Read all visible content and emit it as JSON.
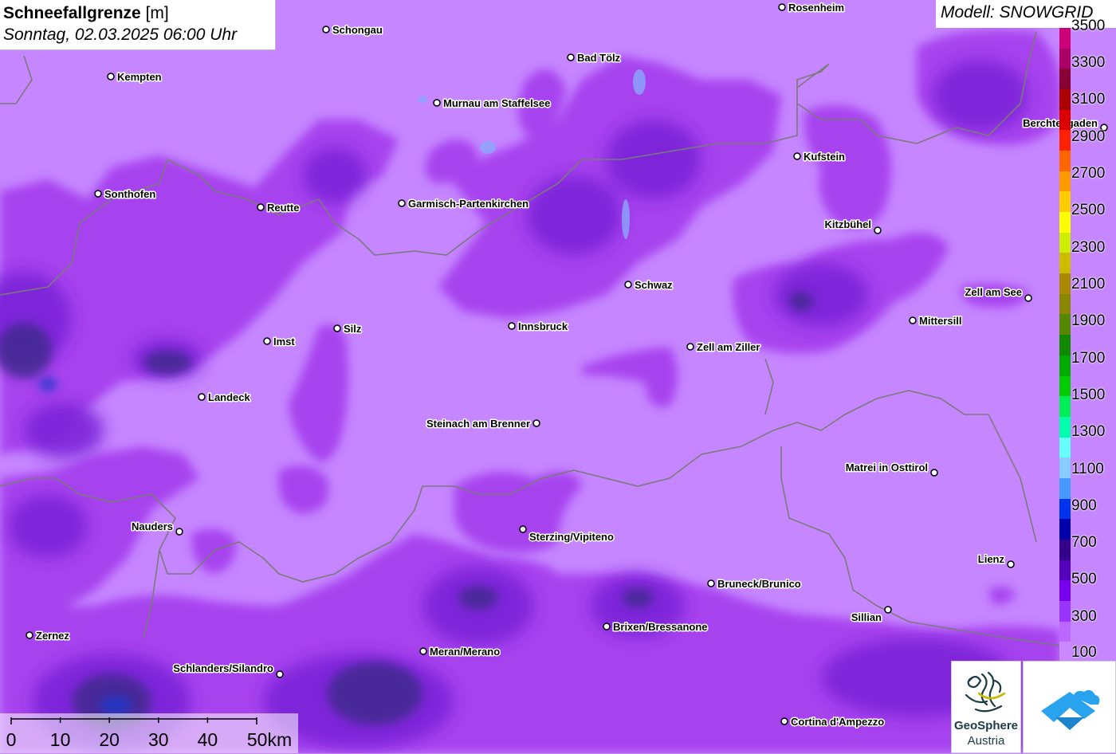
{
  "title": {
    "variable": "Schneefallgrenze",
    "unit": "[m]",
    "datetime": "Sonntag, 02.03.2025 06:00 Uhr"
  },
  "model": "Modell: SNOWGRID",
  "legend": {
    "labels": [
      "3500",
      "3300",
      "3100",
      "2900",
      "2700",
      "2500",
      "2300",
      "2100",
      "1900",
      "1700",
      "1500",
      "1300",
      "1100",
      "900",
      "700",
      "500",
      "300",
      "100"
    ],
    "colors": [
      "#cc0077",
      "#aa0066",
      "#880033",
      "#aa0000",
      "#dd0000",
      "#ff2200",
      "#ff6600",
      "#ff9900",
      "#ffcc00",
      "#ffff00",
      "#ccee00",
      "#ccbb00",
      "#aa8800",
      "#888800",
      "#558800",
      "#118800",
      "#00aa00",
      "#00cc00",
      "#00ee55",
      "#00ffaa",
      "#66ffff",
      "#88ccff",
      "#4499ff",
      "#0033ee",
      "#0000aa",
      "#330088",
      "#5500bb",
      "#7700ee",
      "#9933ff",
      "#bb66ff",
      "#cc88ff"
    ]
  },
  "scale": {
    "labels": [
      "0",
      "10",
      "20",
      "30",
      "40",
      "50km"
    ]
  },
  "cities": [
    {
      "name": "Rosenheim"
    },
    {
      "name": "Schongau"
    },
    {
      "name": "Bad Tölz"
    },
    {
      "name": "Kempten"
    },
    {
      "name": "Murnau am Staffelsee"
    },
    {
      "name": "Berchtesgaden"
    },
    {
      "name": "Kufstein"
    },
    {
      "name": "Sonthofen"
    },
    {
      "name": "Reutte"
    },
    {
      "name": "Garmisch-Partenkirchen"
    },
    {
      "name": "Kitzbühel"
    },
    {
      "name": "Schwaz"
    },
    {
      "name": "Zell am See"
    },
    {
      "name": "Mittersill"
    },
    {
      "name": "Imst"
    },
    {
      "name": "Silz"
    },
    {
      "name": "Innsbruck"
    },
    {
      "name": "Zell am Ziller"
    },
    {
      "name": "Landeck"
    },
    {
      "name": "Steinach am Brenner"
    },
    {
      "name": "Matrei in Osttirol"
    },
    {
      "name": "Nauders"
    },
    {
      "name": "Sterzing/Vipiteno"
    },
    {
      "name": "Lienz"
    },
    {
      "name": "Bruneck/Brunico"
    },
    {
      "name": "Sillian"
    },
    {
      "name": "Brixen/Bressanone"
    },
    {
      "name": "Zernez"
    },
    {
      "name": "Meran/Merano"
    },
    {
      "name": "Schlanders/Silandro"
    },
    {
      "name": "Cortina d'Ampezzo"
    }
  ],
  "logos": {
    "geosphere_line1": "GeoSphere",
    "geosphere_line2": "Austria"
  },
  "colors": {
    "base": "#c586ff",
    "mid": "#a238f0",
    "dark": "#7b1fe0",
    "darker": "#5a1ab0",
    "deep": "#3a2a88",
    "border": "#7a7a7a",
    "water": "#88aaff"
  },
  "icons": [
    "city-dot-icon",
    "geosphere-logo-icon",
    "cloud-logo-icon"
  ]
}
